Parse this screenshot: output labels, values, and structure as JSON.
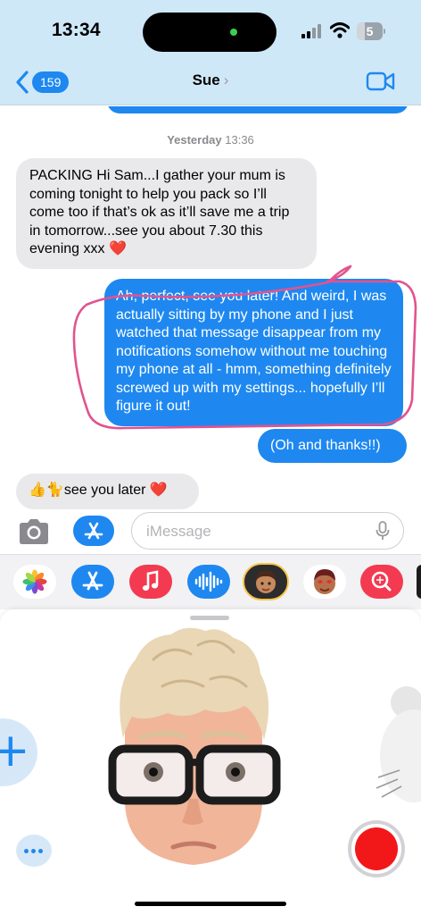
{
  "status_bar": {
    "time": "13:34",
    "battery_level": "5",
    "icons": [
      "signal-icon",
      "wifi-icon",
      "battery-icon"
    ]
  },
  "header": {
    "back_count": "159",
    "contact_name": "Sue",
    "contact_chevron": "›",
    "icons": [
      "chevron-left-icon",
      "video-camera-icon"
    ]
  },
  "thread": {
    "timestamp_day": "Yesterday",
    "timestamp_time": "13:36",
    "messages": [
      {
        "direction": "incoming",
        "text": "PACKING Hi Sam...I gather your mum is coming tonight to help you pack so I’ll come too if that’s ok as it’ll save me a trip in tomorrow...see you about 7.30 this evening xxx ❤️"
      },
      {
        "direction": "outgoing",
        "text": "Ah, perfect, see you later! And weird, I was actually sitting by my phone and I just watched that message disappear from my notifications somehow without me touching my phone at all - hmm, something definitely screwed up with my settings... hopefully I’ll figure it out!"
      },
      {
        "direction": "outgoing",
        "text": "(Oh and thanks!!)"
      },
      {
        "direction": "incoming",
        "text": "👍🐈see you later ❤️"
      }
    ],
    "annotation_color": "#e2538f"
  },
  "composer": {
    "placeholder": "iMessage",
    "icons": [
      "camera-icon",
      "app-store-icon",
      "microphone-icon"
    ]
  },
  "app_strip": {
    "apps": [
      "photos-icon",
      "app-store-icon",
      "music-icon",
      "audio-message-icon",
      "memoji-stickers-icon",
      "memoji-stickers-2-icon",
      "search-images-icon"
    ]
  },
  "memoji_panel": {
    "add_label": "+",
    "icons": [
      "memoji-avatar-icon",
      "mouse-memoji-icon",
      "more-icon",
      "record-icon"
    ]
  },
  "colors": {
    "accent": "#1e88f0",
    "nav_bg": "#cfe8f8",
    "incoming_bubble": "#e9e9eb",
    "record": "#f2181a"
  }
}
